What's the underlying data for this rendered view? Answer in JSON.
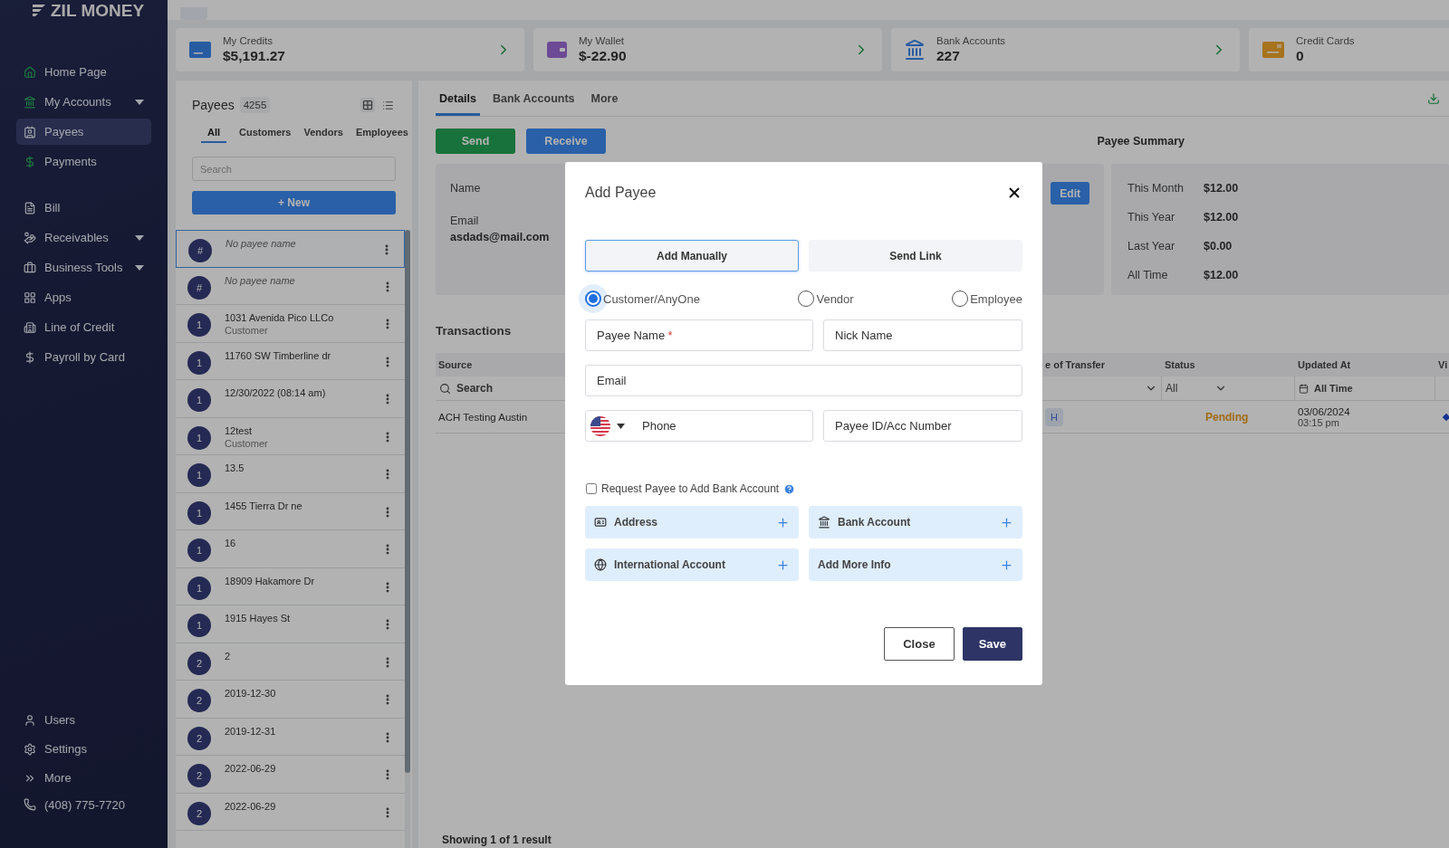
{
  "brand": {
    "name": "ZIL MONEY"
  },
  "nav": [
    {
      "label": "Home Page",
      "selected": false,
      "expandable": false
    },
    {
      "label": "My Accounts",
      "selected": false,
      "expandable": true
    },
    {
      "label": "Payees",
      "selected": true,
      "expandable": false
    },
    {
      "label": "Payments",
      "selected": false,
      "expandable": false
    },
    {
      "label": "Bill",
      "selected": false,
      "expandable": false
    },
    {
      "label": "Receivables",
      "selected": false,
      "expandable": true
    },
    {
      "label": "Business Tools",
      "selected": false,
      "expandable": true
    },
    {
      "label": "Apps",
      "selected": false,
      "expandable": false
    },
    {
      "label": "Line of Credit",
      "selected": false,
      "expandable": false
    },
    {
      "label": "Payroll by Card",
      "selected": false,
      "expandable": false
    }
  ],
  "bottom_nav": [
    {
      "label": "Users"
    },
    {
      "label": "Settings"
    },
    {
      "label": "More"
    },
    {
      "label": "(408) 775-7720"
    }
  ],
  "stat_cards": [
    {
      "label": "My Credits",
      "value": "$5,191.27"
    },
    {
      "label": "My Wallet",
      "value": "$-22.90"
    },
    {
      "label": "Bank Accounts",
      "value": "227"
    },
    {
      "label": "Credit Cards",
      "value": "0"
    }
  ],
  "payees": {
    "title": "Payees",
    "count": "4255",
    "filters": [
      {
        "label": "All",
        "selected": true
      },
      {
        "label": "Customers",
        "selected": false
      },
      {
        "label": "Vendors",
        "selected": false
      },
      {
        "label": "Employees",
        "selected": false
      }
    ],
    "search": {
      "placeholder": "Search"
    },
    "new_button": "+ New",
    "items": [
      {
        "avatar": "#",
        "name": "No payee name",
        "kind": "placeholder",
        "selected": true
      },
      {
        "avatar": "#",
        "name": "No payee name",
        "kind": "placeholder",
        "selected": false
      },
      {
        "avatar": "1",
        "name": "1031 Avenida Pico LLCo",
        "subtitle": "Customer",
        "kind": "name",
        "selected": false
      },
      {
        "avatar": "1",
        "name": "11760 SW Timberline dr",
        "kind": "name",
        "selected": false
      },
      {
        "avatar": "1",
        "name": "12/30/2022 (08:14 am)",
        "kind": "name",
        "selected": false
      },
      {
        "avatar": "1",
        "name": "12test",
        "subtitle": "Customer",
        "kind": "name",
        "selected": false
      },
      {
        "avatar": "1",
        "name": "13.5",
        "kind": "name",
        "selected": false
      },
      {
        "avatar": "1",
        "name": "1455 Tierra Dr ne",
        "kind": "name",
        "selected": false
      },
      {
        "avatar": "1",
        "name": "16",
        "kind": "name",
        "selected": false
      },
      {
        "avatar": "1",
        "name": "18909 Hakamore Dr",
        "kind": "name",
        "selected": false
      },
      {
        "avatar": "1",
        "name": "1915 Hayes St",
        "kind": "name",
        "selected": false
      },
      {
        "avatar": "2",
        "name": "2",
        "kind": "name",
        "selected": false
      },
      {
        "avatar": "2",
        "name": "2019-12-30",
        "kind": "name",
        "selected": false
      },
      {
        "avatar": "2",
        "name": "2019-12-31",
        "kind": "name",
        "selected": false
      },
      {
        "avatar": "2",
        "name": "2022-06-29",
        "kind": "name",
        "selected": false
      },
      {
        "avatar": "2",
        "name": "2022-06-29",
        "kind": "name",
        "selected": false
      }
    ]
  },
  "details": {
    "tabs": [
      {
        "label": "Details",
        "selected": true
      },
      {
        "label": "Bank Accounts",
        "selected": false
      },
      {
        "label": "More",
        "selected": false
      }
    ],
    "actions": [
      {
        "label": "Send",
        "kind": "send"
      },
      {
        "label": "Receive",
        "kind": "receive"
      }
    ],
    "info": {
      "name_label": "Name",
      "email_label": "Email",
      "email": "asdads@mail.com",
      "edit": "Edit"
    },
    "summary": {
      "title": "Payee Summary",
      "rows": [
        {
          "label": "This Month",
          "value": "$12.00"
        },
        {
          "label": "This Year",
          "value": "$12.00"
        },
        {
          "label": "Last Year",
          "value": "$0.00"
        },
        {
          "label": "All Time",
          "value": "$12.00"
        }
      ]
    },
    "transactions": {
      "title": "Transactions",
      "columns": [
        "Source",
        "e of Transfer",
        "Status",
        "Updated At",
        "Vi"
      ],
      "filters": {
        "search": "Search",
        "status": "All",
        "updated": "All Time"
      },
      "rows": [
        {
          "source": "ACH Testing Austin",
          "type": "H",
          "status": "Pending",
          "date": "03/06/2024",
          "time": "03:15 pm"
        }
      ],
      "footer": "Showing 1 of 1 result"
    }
  },
  "modal": {
    "title": "Add Payee",
    "modes": [
      {
        "label": "Add Manually",
        "selected": true
      },
      {
        "label": "Send Link",
        "selected": false
      }
    ],
    "payee_types": [
      {
        "label": "Customer/AnyOne",
        "selected": true
      },
      {
        "label": "Vendor",
        "selected": false
      },
      {
        "label": "Employee",
        "selected": false
      }
    ],
    "fields": [
      {
        "kind": "half",
        "placeholder": "Payee Name",
        "required_mark": "*"
      },
      {
        "kind": "half",
        "placeholder": "Nick Name"
      },
      {
        "kind": "full",
        "placeholder": "Email"
      },
      {
        "kind": "phone",
        "placeholder": "Phone"
      },
      {
        "kind": "half",
        "placeholder": "Payee ID/Acc Number"
      }
    ],
    "request_bank": {
      "label": "Request Payee to Add Bank Account",
      "checked": false
    },
    "sections": [
      {
        "label": "Address"
      },
      {
        "label": "Bank Account"
      },
      {
        "label": "International Account"
      },
      {
        "label": "Add More Info"
      }
    ],
    "buttons": [
      {
        "label": "Close",
        "kind": "secondary"
      },
      {
        "label": "Save",
        "kind": "primary"
      }
    ]
  }
}
